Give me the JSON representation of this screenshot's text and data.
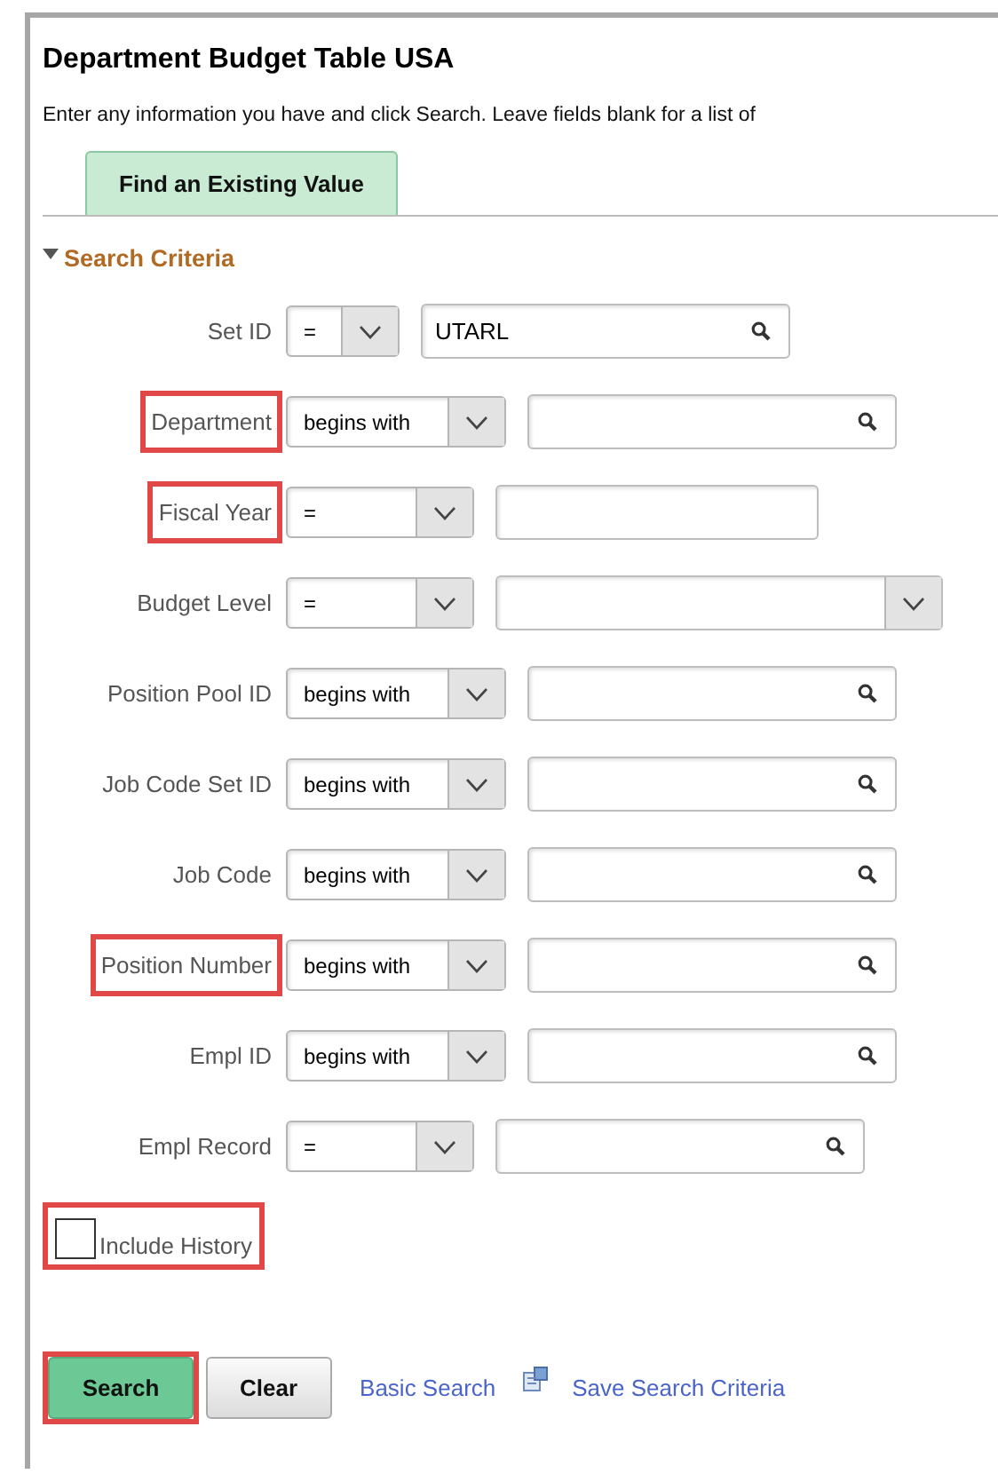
{
  "page": {
    "title": "Department Budget Table USA",
    "instructions": "Enter any information you have and click Search. Leave fields blank for a list of"
  },
  "tabs": [
    {
      "label": "Find an Existing Value",
      "selected": true
    }
  ],
  "section": {
    "title": "Search Criteria",
    "expanded": true
  },
  "fields": [
    {
      "label": "Set ID",
      "highlighted": false,
      "operator": "=",
      "kind": "prompt",
      "value": "UTARL"
    },
    {
      "label": "Department",
      "highlighted": true,
      "operator": "begins with",
      "kind": "lookup"
    },
    {
      "label": "Fiscal Year",
      "highlighted": true,
      "operator": "=",
      "kind": "text"
    },
    {
      "label": "Budget Level",
      "highlighted": false,
      "operator": "=",
      "kind": "dropdown"
    },
    {
      "label": "Position Pool ID",
      "highlighted": false,
      "operator": "begins with",
      "kind": "lookup"
    },
    {
      "label": "Job Code Set ID",
      "highlighted": false,
      "operator": "begins with",
      "kind": "lookup"
    },
    {
      "label": "Job Code",
      "highlighted": false,
      "operator": "begins with",
      "kind": "lookup"
    },
    {
      "label": "Position Number",
      "highlighted": true,
      "operator": "begins with",
      "kind": "lookup"
    },
    {
      "label": "Empl ID",
      "highlighted": false,
      "operator": "begins with",
      "kind": "lookup"
    },
    {
      "label": "Empl Record",
      "highlighted": false,
      "operator": "=",
      "kind": "lookup"
    }
  ],
  "include_history": {
    "label": "Include History",
    "checked": false,
    "highlighted": true
  },
  "buttons": [
    {
      "label": "Search",
      "kind": "primary",
      "highlighted": true
    },
    {
      "label": "Clear",
      "kind": "secondary",
      "highlighted": false
    }
  ],
  "links": [
    {
      "label": "Basic Search",
      "has_icon": false
    },
    {
      "label": "Save Search Criteria",
      "has_icon": true
    }
  ]
}
